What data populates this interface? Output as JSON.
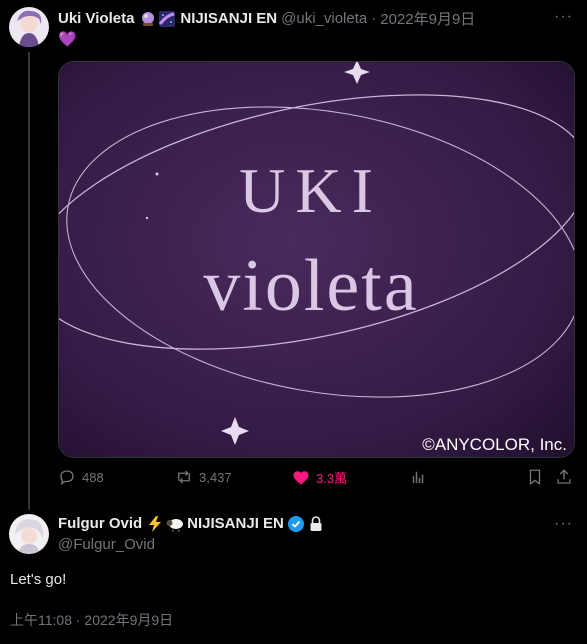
{
  "tweet1": {
    "display_name": "Uki Violeta",
    "affiliation": "NIJISANJI EN",
    "handle": "@uki_violeta",
    "separator": "·",
    "date": "2022年9月9日",
    "text_emoji": "💜",
    "image": {
      "title_line1": "UKI",
      "title_line2": "violeta",
      "copyright": "©ANYCOLOR, Inc."
    },
    "stats": {
      "replies": "488",
      "retweets": "3,437",
      "likes": "3.3萬"
    }
  },
  "tweet2": {
    "display_name": "Fulgur Ovid",
    "affiliation": "NIJISANJI EN",
    "handle": "@Fulgur_Ovid",
    "text": "Let's go!",
    "timestamp": "上午11:08 · 2022年9月9日"
  },
  "colors": {
    "background": "#000000",
    "text": "#e7e9ea",
    "muted": "#71767b",
    "like": "#f91880",
    "verified": "#1d9bf0",
    "image_purple": "#3a1d4b"
  }
}
